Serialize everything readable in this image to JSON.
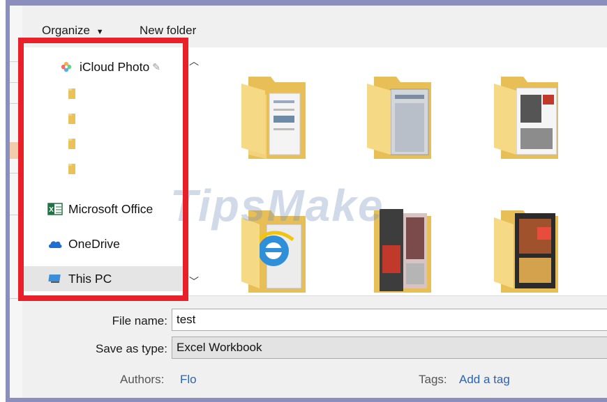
{
  "toolbar": {
    "organize_label": "Organize",
    "new_folder_label": "New folder"
  },
  "nav": {
    "items": [
      {
        "label": "iCloud Photo",
        "icon": "icloud-photos-icon"
      },
      {
        "label": "",
        "icon": "folder-icon"
      },
      {
        "label": "",
        "icon": "folder-icon"
      },
      {
        "label": "",
        "icon": "folder-icon"
      },
      {
        "label": "",
        "icon": "folder-icon"
      },
      {
        "label": "Microsoft Office",
        "icon": "excel-icon"
      },
      {
        "label": "OneDrive",
        "icon": "onedrive-icon"
      },
      {
        "label": "This PC",
        "icon": "computer-icon"
      }
    ]
  },
  "watermark": "TipsMake",
  "form": {
    "file_name_label": "File name:",
    "file_name_value": "test",
    "save_as_type_label": "Save as type:",
    "save_as_type_value": "Excel Workbook",
    "authors_label": "Authors:",
    "authors_value": "Flo",
    "tags_label": "Tags:",
    "tags_value": "Add a tag"
  },
  "colors": {
    "highlight": "#e8202a",
    "folder": "#f2d27a",
    "link": "#2b63b5"
  }
}
